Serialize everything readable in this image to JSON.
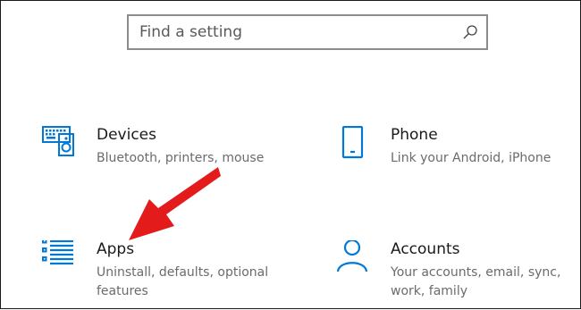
{
  "search": {
    "placeholder": "Find a setting",
    "icon": "search-icon"
  },
  "tiles": [
    {
      "title": "Devices",
      "description": "Bluetooth, printers, mouse",
      "icon": "keyboard-speaker-icon"
    },
    {
      "title": "Phone",
      "description": "Link your Android, iPhone",
      "icon": "phone-icon"
    },
    {
      "title": "Apps",
      "description": "Uninstall, defaults, optional features",
      "icon": "apps-list-icon"
    },
    {
      "title": "Accounts",
      "description": "Your accounts, email, sync, work, family",
      "icon": "person-icon"
    }
  ],
  "annotation": {
    "icon": "red-pointer-arrow",
    "color": "#e31b1b"
  },
  "colors": {
    "accent": "#0078d7",
    "title_text": "#1a1a1a",
    "desc_text": "#6b6b6b",
    "search_border": "#8c8c8c"
  }
}
